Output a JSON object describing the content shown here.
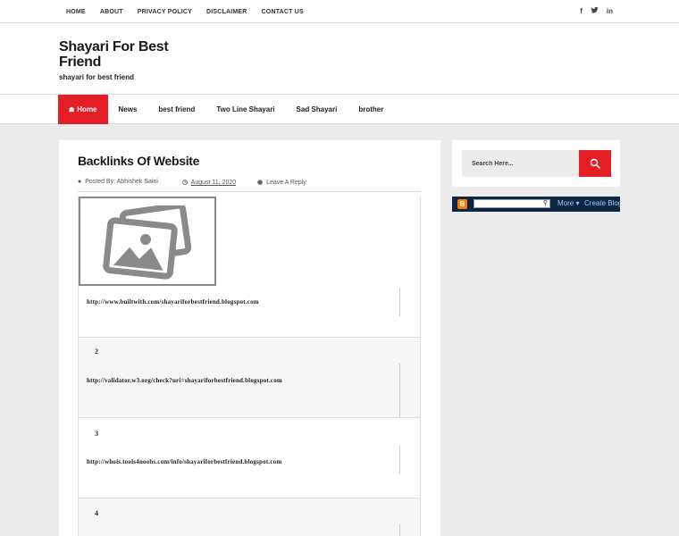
{
  "topnav": {
    "items": [
      "HOME",
      "ABOUT",
      "PRIVACY POLICY",
      "DISCLAIMER",
      "CONTACT US"
    ]
  },
  "social": {
    "icons": [
      "facebook-icon",
      "twitter-icon",
      "linkedin-icon"
    ],
    "glyphs": [
      "f",
      "y",
      "in"
    ]
  },
  "header": {
    "title": "Shayari For Best Friend",
    "tagline": "shayari for best friend"
  },
  "mainnav": {
    "items": [
      "Home",
      "News",
      "best friend",
      "Two Line Shayari",
      "Sad Shayari",
      "brother"
    ],
    "active_color": "#e31e24"
  },
  "post": {
    "title": "Backlinks Of Website",
    "posted_by_label": "Posted By:",
    "author": "Abhishek Saini",
    "date": "August 11, 2020",
    "reply": "Leave A Reply",
    "rows": [
      {
        "num": "",
        "url": "http://www.builtwith.com/shayariforbestfriend.blogspot.com"
      },
      {
        "num": "2",
        "url": "http://validator.w3.org/check?uri=shayariforbestfriend.blogspot.com"
      },
      {
        "num": "3",
        "url": "http://whois.tools4noobs.com/info/shayariforbestfriend.blogspot.com"
      },
      {
        "num": "4",
        "url": ""
      }
    ]
  },
  "sidebar": {
    "search_placeholder": "Search Here...",
    "button_color": "#e31e24"
  },
  "blogger_bar": {
    "logo": "B",
    "more": "More ▾",
    "create": "Create Blog"
  }
}
